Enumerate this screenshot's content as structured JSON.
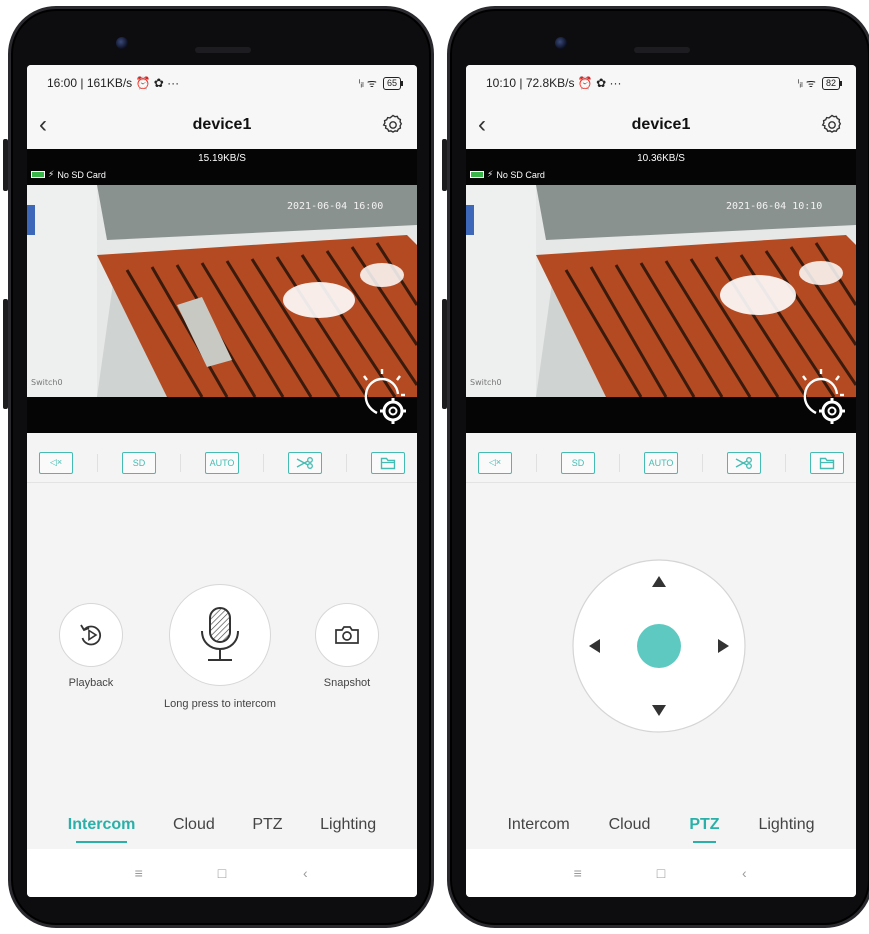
{
  "left": {
    "status": {
      "time": "16:00 | 161KB/s ⏰ ✿ ···",
      "signal": "ⁱᵢₗ ᯤ",
      "battery": "65"
    },
    "title": "device1",
    "video": {
      "speed": "15.19KB/S",
      "sd_text": "No SD Card",
      "timestamp": "2021-06-04 16:00",
      "corner_text": "Switch0"
    },
    "toolbar": {
      "mute": "◁×",
      "sd": "SD",
      "auto": "AUTO"
    },
    "panel": {
      "playback_label": "Playback",
      "intercom_label": "Long press to intercom",
      "snapshot_label": "Snapshot"
    },
    "tabs": [
      "Intercom",
      "Cloud",
      "PTZ",
      "Lighting"
    ],
    "active_tab": "Intercom",
    "nav": {
      "menu": "≡",
      "home": "□",
      "back": "‹"
    }
  },
  "right": {
    "status": {
      "time": "10:10 | 72.8KB/s ⏰ ✿ ···",
      "signal": "ⁱᵢₗ ᯤ",
      "battery": "82"
    },
    "title": "device1",
    "video": {
      "speed": "10.36KB/S",
      "sd_text": "No SD Card",
      "timestamp": "2021-06-04 10:10",
      "corner_text": "Switch0"
    },
    "toolbar": {
      "mute": "◁×",
      "sd": "SD",
      "auto": "AUTO"
    },
    "tabs": [
      "Intercom",
      "Cloud",
      "PTZ",
      "Lighting"
    ],
    "active_tab": "PTZ",
    "nav": {
      "menu": "≡",
      "home": "□",
      "back": "‹"
    }
  },
  "colors": {
    "accent": "#45bcb3",
    "ptz_center": "#5dc9c1"
  },
  "icons": [
    "back-icon",
    "gear-icon",
    "lightbulb-gear-icon",
    "mute-icon",
    "sd-icon",
    "auto-icon",
    "scissors-icon",
    "folder-icon",
    "playback-icon",
    "microphone-icon",
    "camera-icon",
    "arrow-up-icon",
    "arrow-down-icon",
    "arrow-left-icon",
    "arrow-right-icon"
  ]
}
